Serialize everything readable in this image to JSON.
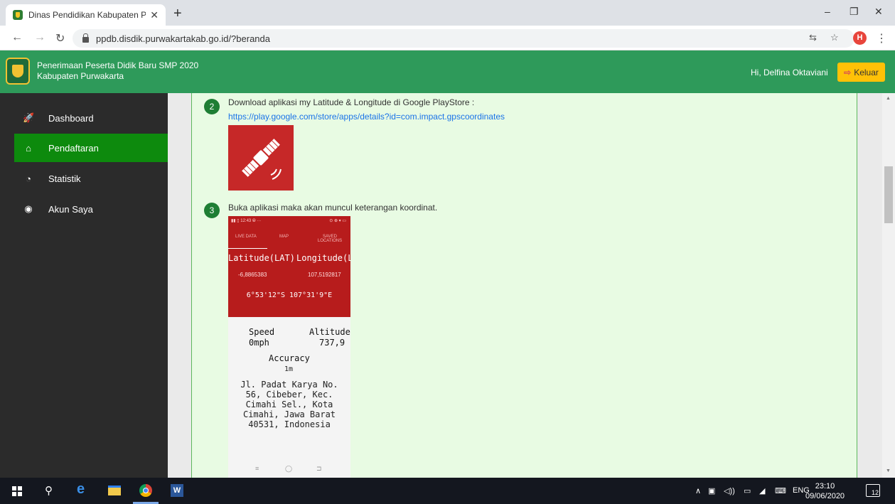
{
  "browser": {
    "tab_title": "Dinas Pendidikan Kabupaten Pur",
    "tab_close": "✕",
    "new_tab": "+",
    "url": "ppdb.disdik.purwakartakab.go.id/?beranda",
    "profile_initial": "H",
    "window_controls": {
      "minimize": "–",
      "maximize": "❐",
      "close": "✕"
    }
  },
  "header": {
    "title_line1": "Penerimaan Peserta Didik Baru SMP 2020",
    "title_line2": "Kabupaten Purwakarta",
    "greeting": "Hi, Delfina Oktaviani",
    "logout_label": "Keluar"
  },
  "sidebar": {
    "items": [
      {
        "label": "Dashboard",
        "icon": "rocket-icon",
        "glyph": "🚀"
      },
      {
        "label": "Pendaftaran",
        "icon": "home-icon",
        "glyph": "⌂"
      },
      {
        "label": "Statistik",
        "icon": "pie-chart-icon",
        "glyph": "◔"
      },
      {
        "label": "Akun Saya",
        "icon": "user-icon",
        "glyph": "◉"
      }
    ],
    "active_index": 1
  },
  "content": {
    "step2": {
      "number": "2",
      "text": "Download aplikasi my Latitude & Longitude di Google PlayStore :",
      "link": "https://play.google.com/store/apps/details?id=com.impact.gpscoordinates"
    },
    "step3": {
      "number": "3",
      "text": "Buka aplikasi maka akan muncul keterangan koordinat."
    },
    "phone": {
      "status_left": "▮▮ ▯ 12:43 ⦾ ···",
      "status_right": "⊙ ⊕ ▾ ▭",
      "tabs": [
        "LIVE DATA",
        "MAP",
        "SAVED LOCATIONS"
      ],
      "lat_label": "Latitude(LAT)",
      "lon_label": "Longitude(LON",
      "lat_value": "-6,8865383",
      "lon_value": "107,5192817",
      "dms": "6°53'12\"S 107°31'9\"E",
      "speed_label": "Speed",
      "speed_value": "0mph",
      "altitude_label": "Altitude",
      "altitude_value": "737,9",
      "accuracy_label": "Accuracy",
      "accuracy_value": "1m",
      "address": "Jl. Padat Karya No.\n56, Cibeber, Kec.\nCimahi Sel., Kota\nCimahi, Jawa Barat\n40531, Indonesia",
      "nav": [
        "≡",
        "◯",
        "⊐"
      ]
    }
  },
  "taskbar": {
    "language": "ENG",
    "time": "23:10",
    "date": "09/06/2020",
    "notification_count": "12"
  },
  "colors": {
    "header_green": "#2e9a5a",
    "active_green": "#0d8a0d",
    "sidebar_dark": "#2b2b2b",
    "logout_yellow": "#ffc107",
    "panel_bg": "#e8fbe3",
    "app_red": "#b71c1c"
  }
}
